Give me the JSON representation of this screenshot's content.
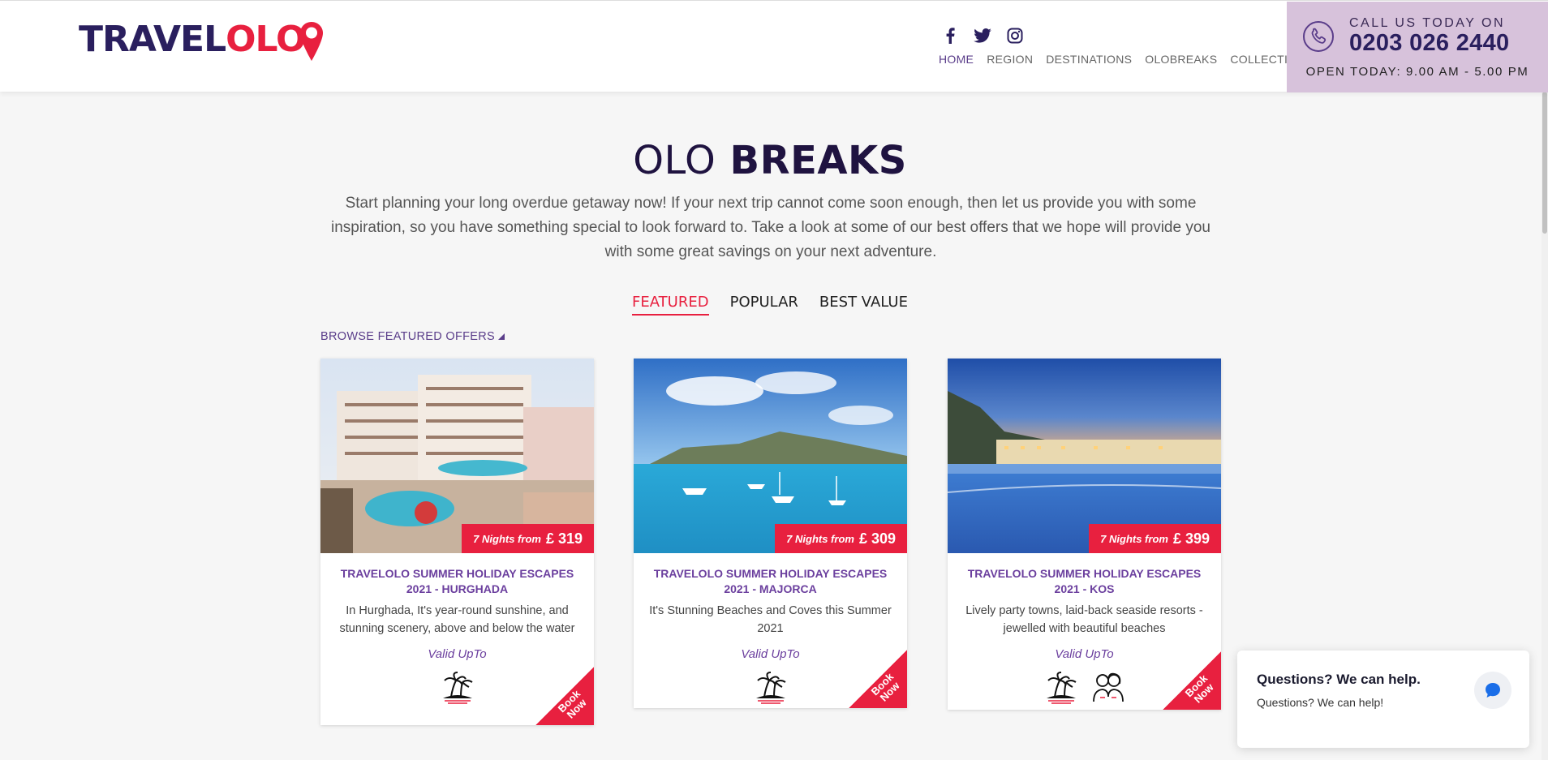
{
  "header": {
    "logo_primary": "TRAVEL",
    "logo_accent": "OLO",
    "social": [
      "facebook-icon",
      "twitter-icon",
      "instagram-icon"
    ],
    "nav": [
      {
        "label": "HOME",
        "active": true
      },
      {
        "label": "REGION",
        "active": false
      },
      {
        "label": "DESTINATIONS",
        "active": false
      },
      {
        "label": "OLOBREAKS",
        "active": false
      },
      {
        "label": "COLLECTIONS",
        "active": false
      }
    ],
    "call": {
      "label": "CALL US TODAY ON",
      "number": "0203 026 2440",
      "hours": "OPEN TODAY: 9.00 AM - 5.00 PM"
    }
  },
  "main": {
    "title_light": "OLO",
    "title_bold": "BREAKS",
    "intro": "Start planning your long overdue getaway now! If your next trip cannot come soon enough, then let us provide you with some inspiration, so you have something special to look forward to. Take a look at some of our best offers that we hope will provide you with some great savings on your next adventure.",
    "tabs": [
      {
        "label": "FEATURED",
        "active": true
      },
      {
        "label": "POPULAR",
        "active": false
      },
      {
        "label": "BEST VALUE",
        "active": false
      }
    ],
    "browse_label": "BROWSE FEATURED OFFERS"
  },
  "cards": [
    {
      "nights": "7 Nights from",
      "price": "£ 319",
      "title": "TRAVELOLO SUMMER HOLIDAY ESCAPES 2021 - HURGHADA",
      "desc": "In Hurghada, It's year-round sunshine, and stunning scenery, above and below the water",
      "valid": "Valid UpTo",
      "book": "Book Now",
      "icons": [
        "palm-island-icon"
      ]
    },
    {
      "nights": "7 Nights from",
      "price": "£ 309",
      "title": "TRAVELOLO SUMMER HOLIDAY ESCAPES 2021 - MAJORCA",
      "desc": "It's Stunning Beaches and Coves this Summer 2021",
      "valid": "Valid UpTo",
      "book": "Book Now",
      "icons": [
        "palm-island-icon"
      ]
    },
    {
      "nights": "7 Nights from",
      "price": "£ 399",
      "title": "TRAVELOLO SUMMER HOLIDAY ESCAPES 2021 - KOS",
      "desc": "Lively party towns, laid-back seaside resorts - jewelled with beautiful beaches",
      "valid": "Valid UpTo",
      "book": "Book Now",
      "icons": [
        "palm-island-icon",
        "couple-icon"
      ]
    }
  ],
  "chat": {
    "heading": "Questions? We can help.",
    "subtext": "Questions? We can help!"
  },
  "colors": {
    "brand_navy": "#2a1f5e",
    "brand_red": "#e8203f",
    "brand_purple": "#6b3f9e",
    "callbox_bg": "#d7c2db"
  }
}
